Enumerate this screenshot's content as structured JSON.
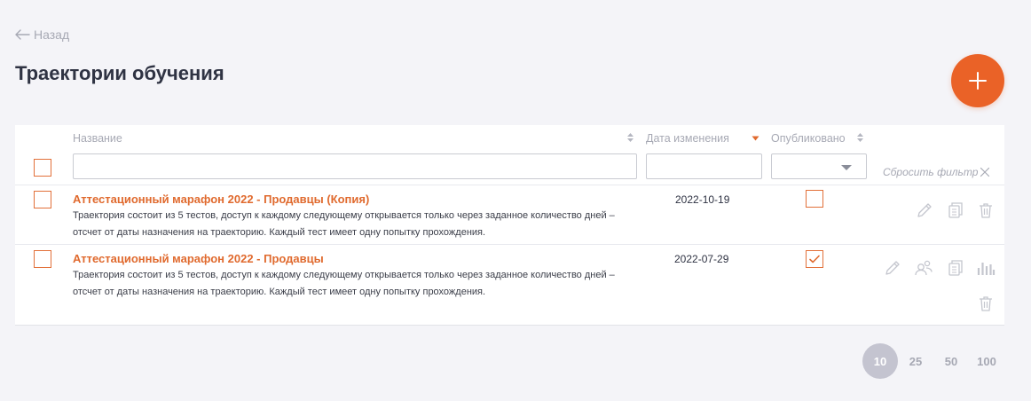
{
  "nav": {
    "back_label": "Назад"
  },
  "page": {
    "title": "Траектории обучения"
  },
  "table": {
    "columns": {
      "name": "Название",
      "date": "Дата изменения",
      "published": "Опубликовано"
    },
    "filters": {
      "name_value": "",
      "date_value": "",
      "published_value": ""
    },
    "reset_filter_label": "Сбросить фильтр",
    "rows": [
      {
        "title": "Аттестационный марафон 2022 - Продавцы (Копия)",
        "description": "Траектория состоит из 5 тестов, доступ к каждому следующему открывается только через заданное количество дней – отсчет от даты назначения на траекторию. Каждый тест имеет одну попытку прохождения.",
        "date": "2022-10-19",
        "published": false,
        "actions": [
          "pencil-icon",
          "copy-icon",
          "trash-icon"
        ]
      },
      {
        "title": "Аттестационный марафон 2022 - Продавцы",
        "description": "Траектория состоит из 5 тестов, доступ к каждому следующему открывается только через заданное количество дней – отсчет от даты назначения на траекторию. Каждый тест имеет одну попытку прохождения.",
        "date": "2022-07-29",
        "published": true,
        "actions": [
          "pencil-icon",
          "users-icon",
          "copy-icon",
          "stats-icon",
          "trash-icon"
        ]
      }
    ]
  },
  "pagination": {
    "sizes": [
      "10",
      "25",
      "50",
      "100"
    ],
    "active": "10"
  },
  "colors": {
    "accent": "#ea6227",
    "link": "#e06a2e",
    "muted": "#a7a9b4",
    "background": "#f4f4f8"
  }
}
